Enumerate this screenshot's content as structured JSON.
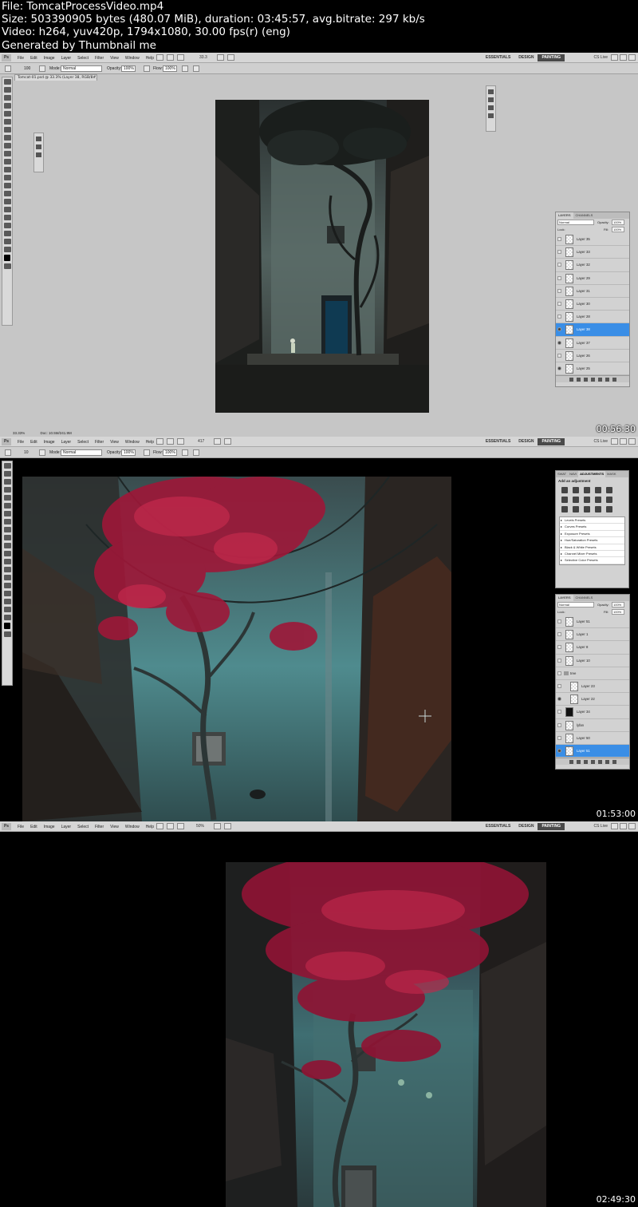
{
  "header": {
    "line1": "File: TomcatProcessVideo.mp4",
    "line2": "Size: 503390905 bytes (480.07 MiB), duration: 03:45:57, avg.bitrate: 297 kb/s",
    "line3": "Video: h264, yuv420p, 1794x1080, 30.00 fps(r) (eng)",
    "line4": "Generated by Thumbnail me"
  },
  "menu": {
    "logo": "Ps",
    "items": [
      "File",
      "Edit",
      "Image",
      "Layer",
      "Select",
      "Filter",
      "View",
      "Window",
      "Help"
    ],
    "workspaces": [
      "ESSENTIALS",
      "DESIGN",
      "PAINTING"
    ],
    "active_workspace": "PAINTING",
    "cs_live": "CS Live"
  },
  "frame1": {
    "timestamp": "00:56:30",
    "zoom_dropdown": "33.3",
    "options": {
      "brush_size": "100",
      "mode_label": "Mode:",
      "mode_value": "Normal",
      "opacity_label": "Opacity:",
      "opacity_value": "100%",
      "flow_label": "Flow:",
      "flow_value": "100%"
    },
    "document_tab": "Tomcat-01.psd @ 33.3% (Layer 38, RGB/8#) *",
    "status": {
      "zoom": "33.33%",
      "doc": "Doc: 10.5M/241.9M"
    },
    "layers_panel": {
      "tabs": [
        "LAYERS",
        "CHANNELS"
      ],
      "blend": "Normal",
      "opacity_label": "Opacity:",
      "opacity": "100%",
      "lock_label": "Lock:",
      "fill_label": "Fill:",
      "fill": "100%",
      "layers": [
        {
          "name": "Layer 35",
          "visible": false,
          "selected": false
        },
        {
          "name": "Layer 33",
          "visible": false,
          "selected": false
        },
        {
          "name": "Layer 32",
          "visible": false,
          "selected": false
        },
        {
          "name": "Layer 29",
          "visible": false,
          "selected": false
        },
        {
          "name": "Layer 31",
          "visible": false,
          "selected": false
        },
        {
          "name": "Layer 30",
          "visible": false,
          "selected": false
        },
        {
          "name": "Layer 28",
          "visible": false,
          "selected": false
        },
        {
          "name": "Layer 38",
          "visible": true,
          "selected": true
        },
        {
          "name": "Layer 37",
          "visible": true,
          "selected": false
        },
        {
          "name": "Layer 26",
          "visible": false,
          "selected": false
        },
        {
          "name": "Layer 25",
          "visible": true,
          "selected": false
        }
      ]
    }
  },
  "frame2": {
    "timestamp": "01:53:00",
    "zoom_dropdown": "417",
    "options": {
      "brush_size": "10",
      "mode_label": "Mode:",
      "mode_value": "Normal",
      "opacity_label": "Opacity:",
      "opacity_value": "100%",
      "flow_label": "Flow:",
      "flow_value": "100%"
    },
    "adjustments_panel": {
      "tabs": [
        "SWAT",
        "NAVI",
        "ADJUSTMENTS",
        "MASK"
      ],
      "active_tab": "ADJUSTMENTS",
      "title": "Add an adjustment",
      "presets": [
        "Levels Presets",
        "Curves Presets",
        "Exposure Presets",
        "Hue/Saturation Presets",
        "Black & White Presets",
        "Channel Mixer Presets",
        "Selective Color Presets"
      ]
    },
    "layers_panel": {
      "tabs": [
        "LAYERS",
        "CHANNELS"
      ],
      "blend": "Normal",
      "opacity_label": "Opacity:",
      "opacity": "100%",
      "lock_label": "Lock:",
      "fill_label": "Fill:",
      "fill": "100%",
      "layers": [
        {
          "name": "Layer 51",
          "visible": false,
          "selected": false,
          "kind": "layer"
        },
        {
          "name": "Layer 1",
          "visible": false,
          "selected": false,
          "kind": "layer"
        },
        {
          "name": "Layer 8",
          "visible": false,
          "selected": false,
          "kind": "layer"
        },
        {
          "name": "Layer 10",
          "visible": false,
          "selected": false,
          "kind": "layer"
        },
        {
          "name": "tree",
          "visible": false,
          "selected": false,
          "kind": "group"
        },
        {
          "name": "Layer 23",
          "visible": false,
          "selected": false,
          "kind": "child"
        },
        {
          "name": "Layer 22",
          "visible": true,
          "selected": false,
          "kind": "child"
        },
        {
          "name": "Layer 34",
          "visible": false,
          "selected": false,
          "kind": "dark"
        },
        {
          "name": "lyfan",
          "visible": false,
          "selected": false,
          "kind": "layer"
        },
        {
          "name": "Layer 50",
          "visible": false,
          "selected": false,
          "kind": "layer"
        },
        {
          "name": "Layer 51",
          "visible": true,
          "selected": true,
          "kind": "layer"
        }
      ]
    }
  },
  "frame3": {
    "timestamp": "02:49:30",
    "zoom_dropdown": "50%"
  },
  "colors": {
    "ps_gray": "#c6c6c6",
    "layer_selected": "#3a8ee6",
    "foliage": "#a0183a",
    "wall": "#3e7e80"
  }
}
